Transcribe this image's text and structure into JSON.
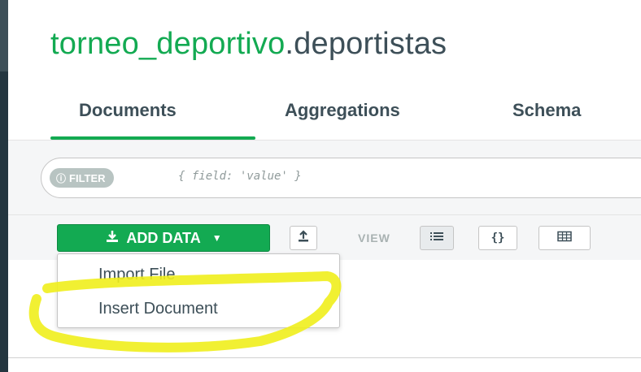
{
  "header": {
    "database": "torneo_deportivo",
    "collection": ".deportistas"
  },
  "tabs": [
    {
      "label": "Documents",
      "active": true
    },
    {
      "label": "Aggregations",
      "active": false
    },
    {
      "label": "Schema",
      "active": false
    }
  ],
  "filter": {
    "badge": "FILTER",
    "placeholder": "{ field: 'value' }"
  },
  "toolbar": {
    "add_data_label": "ADD DATA",
    "view_label": "VIEW",
    "view_options": [
      "list-view-icon",
      "json-view-icon",
      "table-view-icon"
    ]
  },
  "dropdown": {
    "items": [
      "Import File",
      "Insert Document"
    ]
  },
  "colors": {
    "accent": "#13aa52",
    "text": "#3d4f58",
    "highlight": "#f0ee1c"
  }
}
